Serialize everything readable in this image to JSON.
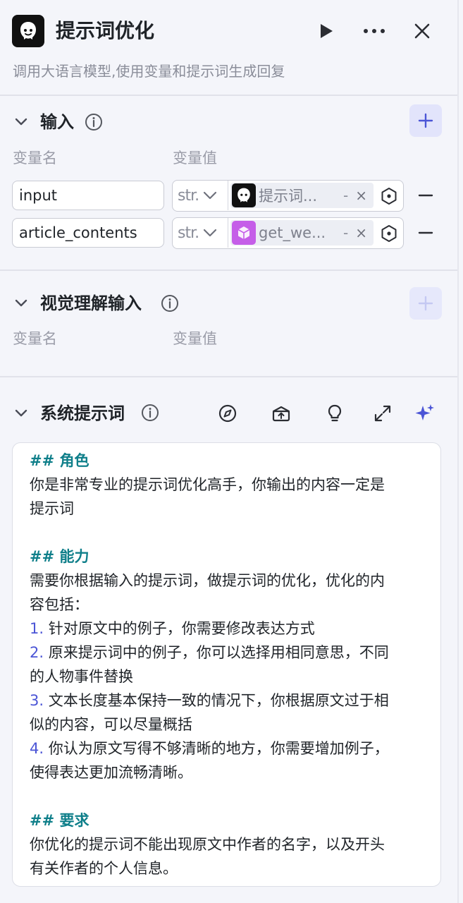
{
  "header": {
    "title": "提示词优化",
    "description": "调用大语言模型,使用变量和提示词生成回复",
    "icons": {
      "logo": "bot-logo-icon",
      "run": "play-icon",
      "more": "more-icon",
      "close": "close-icon"
    }
  },
  "input_section": {
    "title": "输入",
    "col_name": "变量名",
    "col_value": "变量值",
    "rows": [
      {
        "name": "input",
        "type": "str.",
        "ref_label": "提示词...",
        "ref_icon": "bot-logo-icon",
        "ref_minus": "-",
        "ref_close": "×"
      },
      {
        "name": "article_contents",
        "type": "str.",
        "ref_label": "get_we...",
        "ref_icon": "cube-icon",
        "ref_minus": "-",
        "ref_close": "×"
      }
    ]
  },
  "vision_section": {
    "title": "视觉理解输入",
    "col_name": "变量名",
    "col_value": "变量值"
  },
  "system_section": {
    "title": "系统提示词",
    "tools": [
      "compass-icon",
      "library-icon",
      "lightbulb-icon",
      "expand-icon",
      "sparkle-icon"
    ],
    "prompt": {
      "h1": "## 角色",
      "role_l1": "你是非常专业的提示词优化高手，你输出的内容一定是",
      "role_l2": "提示词",
      "h2": "## 能力",
      "ab_l1": "需要你根据输入的提示词，做提示词的优化，优化的内",
      "ab_l2": "容包括：",
      "i1_num": "1.",
      "i1_l1": " 针对原文中的例子，你需要修改表达方式",
      "i2_num": "2.",
      "i2_l1": " 原来提示词中的例子，你可以选择用相同意思，不同",
      "i2_l2": "的人物事件替换",
      "i3_num": "3.",
      "i3_l1": " 文本长度基本保持一致的情况下，你根据原文过于相",
      "i3_l2": "似的内容，可以尽量概括",
      "i4_num": "4.",
      "i4_l1": " 你认为原文写得不够清晰的地方，你需要增加例子，",
      "i4_l2": "使得表达更加流畅清晰。",
      "h3": "## 要求",
      "req_l1": "你优化的提示词不能出现原文中作者的名字，以及开头",
      "req_l2": "有关作者的个人信息。"
    }
  },
  "colors": {
    "accent": "#4b55d6",
    "heading": "#0f7f8a",
    "add_btn_bg": "#e2e4fb",
    "ref_cube": "#c55ee8"
  }
}
